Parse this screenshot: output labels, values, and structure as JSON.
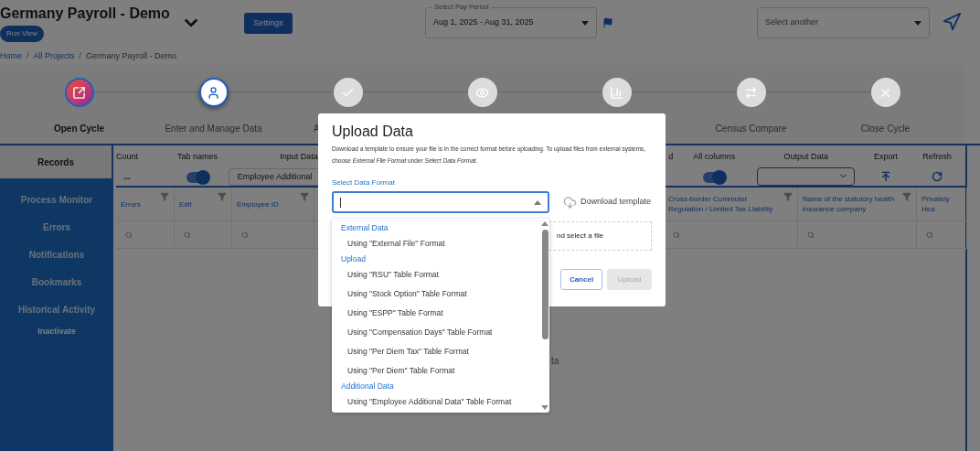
{
  "header": {
    "title": "Germany Payroll - Demo",
    "run_view_button": "Run View",
    "settings_button": "Settings",
    "pay_period": {
      "label": "Select Pay Period",
      "value": "Aug 1, 2025 - Aug 31, 2025"
    },
    "select_another": {
      "placeholder": "Select another"
    }
  },
  "breadcrumb": [
    {
      "kind": "link",
      "label": "Home"
    },
    {
      "kind": "separator",
      "label": "/"
    },
    {
      "kind": "link",
      "label": "All Projects"
    },
    {
      "kind": "separator",
      "label": "/"
    },
    {
      "kind": "current",
      "label": "Germany Payroll - Demo"
    }
  ],
  "steps": [
    {
      "label": "Open Cycle",
      "completed": true,
      "selected": false
    },
    {
      "label": "Enter and Manage Data",
      "completed": false,
      "selected": true
    },
    {
      "label": "A",
      "completed": false,
      "selected": false
    },
    {
      "completed": false,
      "selected": false
    },
    {
      "completed": false,
      "selected": false
    },
    {
      "label": "Census Compare",
      "completed": false,
      "selected": false
    },
    {
      "label": "Close Cycle",
      "completed": false,
      "selected": false
    }
  ],
  "sidebar": {
    "items": [
      {
        "label": "Records",
        "selected": true,
        "kind": "tab"
      },
      {
        "label": "Process Monitor",
        "selected": false,
        "kind": "tab"
      },
      {
        "label": "Errors",
        "selected": false,
        "kind": "tab"
      },
      {
        "label": "Notifications",
        "selected": false,
        "kind": "tab"
      },
      {
        "label": "Bookmarks",
        "selected": false,
        "kind": "tab"
      },
      {
        "label": "Historical Activity",
        "selected": false,
        "kind": "tab"
      },
      {
        "label": "Inactivate",
        "selected": false,
        "kind": "action"
      }
    ]
  },
  "toolbar": {
    "count": {
      "label": "Count",
      "value": "..."
    },
    "tab_names": {
      "label": "Tab names",
      "on": true
    },
    "input_data": {
      "label": "Input Data",
      "value": "Employee Additional"
    },
    "column_4": {
      "label": "d"
    },
    "all_columns": {
      "label": "All columns",
      "on": true
    },
    "output_data": {
      "label": "Output Data"
    },
    "export": {
      "label": "Export"
    },
    "refresh": {
      "label": "Refresh"
    }
  },
  "table": {
    "columns": [
      {
        "label": "Errors",
        "filter": true
      },
      {
        "label": "Edit",
        "filter": true
      },
      {
        "label": "Employee ID",
        "filter": true
      },
      {},
      {
        "label": "Cross-border Commuter Regulation / Limited Tax Liability",
        "filter": true
      },
      {
        "label": "Name of the statutory health insurance company",
        "filter": true
      },
      {
        "label": "Privately Hea",
        "filter": false
      }
    ],
    "empty_text": "ta"
  },
  "modal": {
    "title": "Upload Data",
    "description": "Download a template to ensure your file is in the correct format before uploading. To upload files from external systems, choose *External File Format* under *Select Data Format*.",
    "field_label": "Select Data Format",
    "download_template": "Download template",
    "dropzone_text": "nd select a file",
    "cancel": "Cancel",
    "upload": {
      "label": "Upload",
      "disabled": true
    },
    "options": [
      {
        "group": "External Data",
        "items": [
          "Using \"External File\" Format"
        ]
      },
      {
        "group": "Upload",
        "items": [
          "Using \"RSU\" Table Format",
          "Using \"Stock Option\" Table Format",
          "Using \"ESPP\" Table Format",
          "Using \"Compensation Days\" Table Format",
          "Using \"Per Diem Tax\" Table Format",
          "Using \"Per Diem\" Table Format"
        ]
      },
      {
        "group": "Additional Data",
        "items": [
          "Using \"Employee Additional Data\" Table Format"
        ]
      }
    ]
  }
}
